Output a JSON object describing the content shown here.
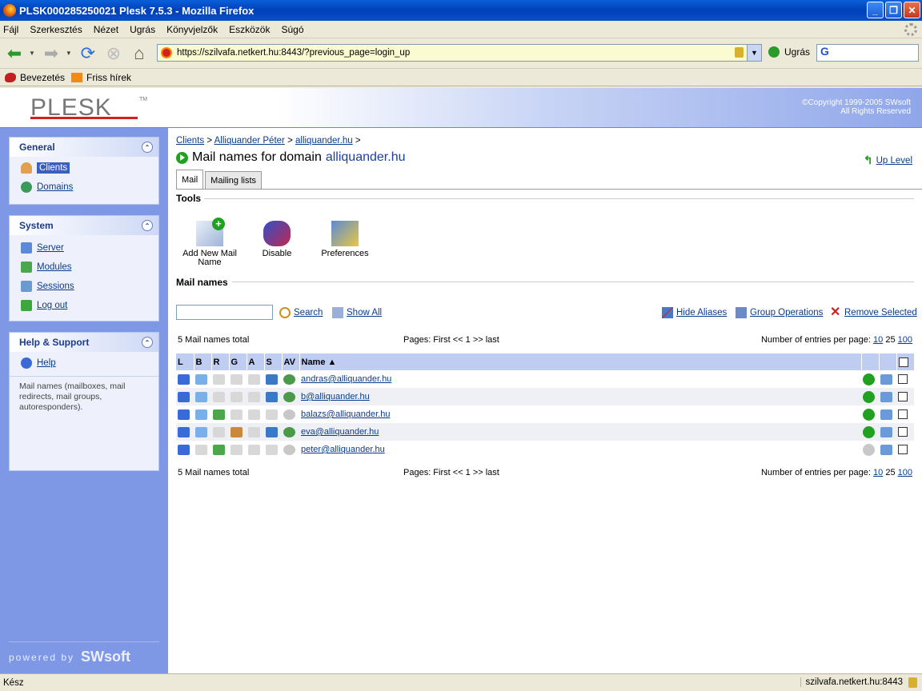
{
  "window": {
    "title": "PLSK000285250021 Plesk 7.5.3 - Mozilla Firefox"
  },
  "menu": [
    "Fájl",
    "Szerkesztés",
    "Nézet",
    "Ugrás",
    "Könyvjelzők",
    "Eszközök",
    "Súgó"
  ],
  "nav": {
    "url": "https://szilvafa.netkert.hu:8443/?previous_page=login_up",
    "go_label": "Ugrás",
    "search_engine": "G"
  },
  "bookmarks": [
    "Bevezetés",
    "Friss hírek"
  ],
  "header": {
    "logo": "PLESK",
    "logo_tm": "TM",
    "copyright_line1": "©Copyright 1999-2005 SWsoft",
    "copyright_line2": "All Rights Reserved"
  },
  "sidebar": {
    "general": {
      "title": "General",
      "items": [
        "Clients",
        "Domains"
      ]
    },
    "system": {
      "title": "System",
      "items": [
        "Server",
        "Modules",
        "Sessions",
        "Log out"
      ]
    },
    "help": {
      "title": "Help & Support",
      "items": [
        "Help"
      ],
      "text": "Mail names (mailboxes, mail redirects, mail groups, autoresponders)."
    },
    "powered_by": "powered by",
    "powered_brand": "SWsoft"
  },
  "main": {
    "breadcrumb": {
      "b1": "Clients",
      "sep1": ">",
      "b2": "Alliquander Péter",
      "sep2": ">",
      "b3": "alliquander.hu",
      "sep3": ">"
    },
    "title_prefix": "Mail names for domain",
    "title_domain": "alliquander.hu",
    "up_level": "Up Level",
    "tabs": [
      "Mail",
      "Mailing lists"
    ],
    "tools_label": "Tools",
    "tools": [
      "Add New Mail Name",
      "Disable",
      "Preferences"
    ],
    "mailnames_label": "Mail names",
    "search_button": "Search",
    "show_all": "Show All",
    "hide_aliases": "Hide Aliases",
    "group_operations": "Group Operations",
    "remove_selected": "Remove Selected",
    "total": "5 Mail names total",
    "pages": "Pages: First << 1 >> last",
    "entries_label": "Number of entries per page:",
    "entries": [
      "10",
      "25",
      "100"
    ],
    "columns": [
      "L",
      "B",
      "R",
      "G",
      "A",
      "S",
      "AV",
      "Name ▲"
    ],
    "rows": [
      {
        "name": "andras@alliquander.hu"
      },
      {
        "name": "b@alliquander.hu"
      },
      {
        "name": "balazs@alliquander.hu"
      },
      {
        "name": "eva@alliquander.hu"
      },
      {
        "name": "peter@alliquander.hu"
      }
    ]
  },
  "status": {
    "left": "Kész",
    "right": "szilvafa.netkert.hu:8443"
  }
}
